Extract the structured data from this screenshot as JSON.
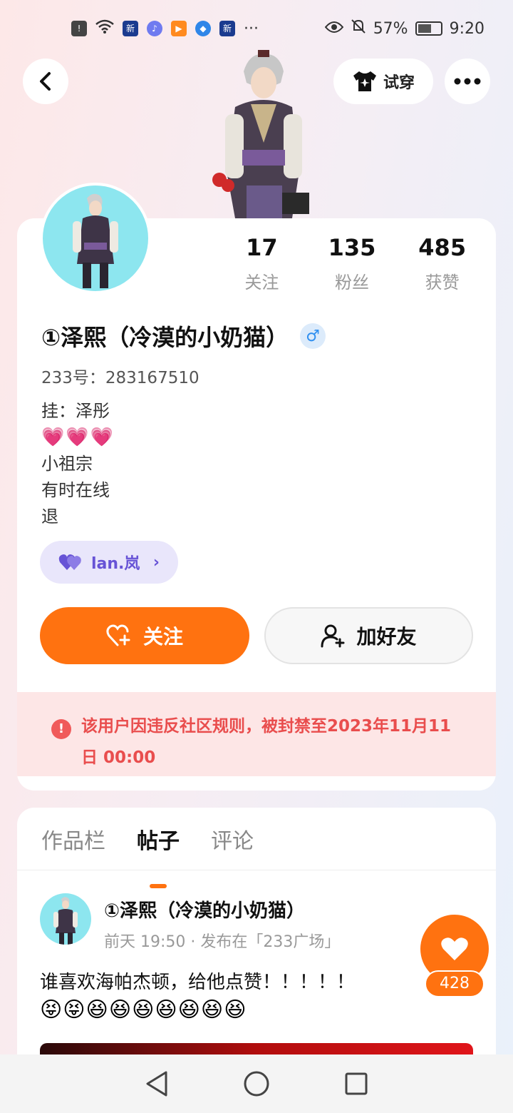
{
  "status_bar": {
    "battery": "57%",
    "time": "9:20",
    "ellipsis": "···"
  },
  "header": {
    "try_on_label": "试穿"
  },
  "profile": {
    "stats": [
      {
        "value": "17",
        "label": "关注"
      },
      {
        "value": "135",
        "label": "粉丝"
      },
      {
        "value": "485",
        "label": "获赞"
      }
    ],
    "nickname": "①泽熙（冷漠的小奶猫）",
    "gender_symbol": "♂",
    "uid_text": "233号：283167510",
    "bio_line1": "挂：泽彤",
    "bio_hearts": [
      "💗",
      "💗",
      "💗"
    ],
    "bio_line3": "小祖宗",
    "bio_line4": "有时在线",
    "bio_line5": "退",
    "tag_label": "lan.岚",
    "follow_label": "关注",
    "add_friend_label": "加好友",
    "ban_notice": "该用户因违反社区规则，被封禁至2023年11月11日 00:00"
  },
  "tabs": [
    {
      "label": "作品栏",
      "active": false
    },
    {
      "label": "帖子",
      "active": true
    },
    {
      "label": "评论",
      "active": false
    }
  ],
  "post": {
    "author": "①泽熙（冷漠的小奶猫）",
    "meta": "前天 19:50 · 发布在「233广场」",
    "text": "谁喜欢海帕杰顿，给他点赞！！！！！",
    "emojis": "😝😝😆😆😆😆😆😆😆"
  },
  "like": {
    "count": "428"
  },
  "colors": {
    "accent": "#ff7210",
    "ban_text": "#e94d4d",
    "ban_bg": "#fde6e6",
    "tag_bg": "#e9e6fb",
    "tag_text": "#6753d6"
  }
}
